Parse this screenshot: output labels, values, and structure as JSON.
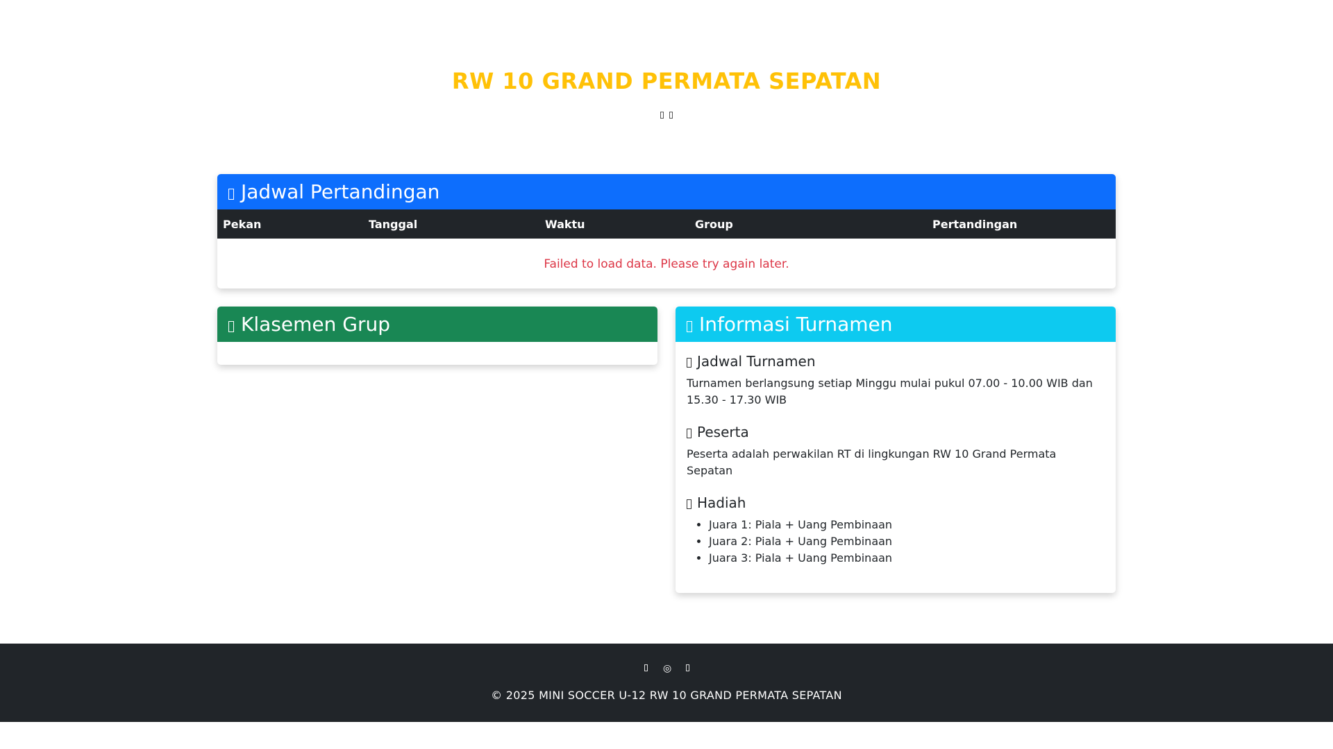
{
  "hero": {
    "title": "RW 10 GRAND PERMATA SEPATAN",
    "subtitle_icons": [
      "football-icon",
      "trophy-icon"
    ]
  },
  "schedule": {
    "title": "Jadwal Pertandingan",
    "icon": "calendar-icon",
    "columns": [
      "Pekan",
      "Tanggal",
      "Waktu",
      "Group",
      "Pertandingan"
    ],
    "error_message": "Failed to load data. Please try again later."
  },
  "standings": {
    "title": "Klasemen Grup",
    "icon": "list-icon"
  },
  "info": {
    "title": "Informasi Turnamen",
    "icon": "info-icon",
    "sections": [
      {
        "heading": "Jadwal Turnamen",
        "icon": "clock-icon",
        "text": "Turnamen berlangsung setiap Minggu mulai pukul 07.00 - 10.00 WIB dan 15.30 - 17.30 WIB"
      },
      {
        "heading": "Peserta",
        "icon": "users-icon",
        "text": "Peserta adalah perwakilan RT di lingkungan RW 10 Grand Permata Sepatan"
      },
      {
        "heading": "Hadiah",
        "icon": "trophy-icon"
      }
    ],
    "prizes": [
      "Juara 1: Piala + Uang Pembinaan",
      "Juara 2: Piala + Uang Pembinaan",
      "Juara 3: Piala + Uang Pembinaan"
    ]
  },
  "footer": {
    "social_icons": [
      "facebook-icon",
      "instagram-icon",
      "whatsapp-icon"
    ],
    "copyright": "© 2025 MINI SOCCER U-12 RW 10 GRAND PERMATA SEPATAN"
  },
  "colors": {
    "title": "#ffc107",
    "schedule_header": "#0d6efd",
    "standings_header": "#198754",
    "info_header": "#0dcaf0",
    "error": "#dc3545",
    "footer": "#212529"
  }
}
